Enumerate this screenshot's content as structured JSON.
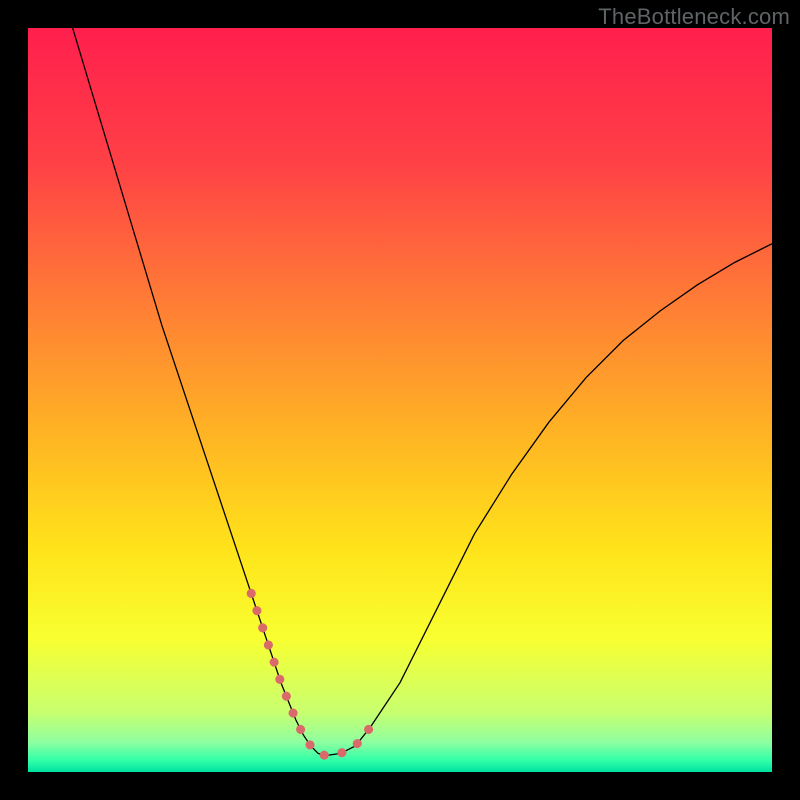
{
  "chart_data": {
    "type": "line",
    "title": "",
    "watermark": "TheBottleneck.com",
    "xlabel": "",
    "ylabel": "",
    "xlim": [
      0,
      100
    ],
    "ylim": [
      0,
      100
    ],
    "grid": false,
    "background_gradient": {
      "direction": "vertical",
      "stops": [
        {
          "offset": 0.0,
          "color": "#ff1f4d"
        },
        {
          "offset": 0.18,
          "color": "#ff4046"
        },
        {
          "offset": 0.36,
          "color": "#ff7a36"
        },
        {
          "offset": 0.54,
          "color": "#ffb224"
        },
        {
          "offset": 0.7,
          "color": "#ffe31a"
        },
        {
          "offset": 0.82,
          "color": "#f8ff30"
        },
        {
          "offset": 0.92,
          "color": "#c8ff70"
        },
        {
          "offset": 0.96,
          "color": "#8effa0"
        },
        {
          "offset": 0.985,
          "color": "#2effa8"
        },
        {
          "offset": 1.0,
          "color": "#00e0a0"
        }
      ]
    },
    "series": [
      {
        "name": "bottleneck-curve",
        "color": "#000000",
        "width": 1.3,
        "x": [
          6,
          9,
          12,
          15,
          18,
          21,
          24,
          27,
          30,
          32,
          34,
          36,
          37,
          38,
          39,
          40,
          42,
          44,
          46,
          50,
          55,
          60,
          65,
          70,
          75,
          80,
          85,
          90,
          95,
          100
        ],
        "y": [
          100,
          90,
          80,
          70,
          60,
          51,
          42,
          33,
          24,
          18,
          12,
          7,
          5,
          3.5,
          2.5,
          2.2,
          2.5,
          3.5,
          6,
          12,
          22,
          32,
          40,
          47,
          53,
          58,
          62,
          65.5,
          68.5,
          71
        ]
      },
      {
        "name": "highlight-segment",
        "color": "#da6a6a",
        "width": 9,
        "linecap": "round",
        "dash": [
          0.1,
          18
        ],
        "x": [
          30,
          32,
          34,
          36,
          37,
          38,
          39,
          40,
          42,
          44,
          46
        ],
        "y": [
          24,
          18,
          12,
          7,
          5,
          3.5,
          2.5,
          2.2,
          2.5,
          3.5,
          6
        ]
      }
    ]
  }
}
